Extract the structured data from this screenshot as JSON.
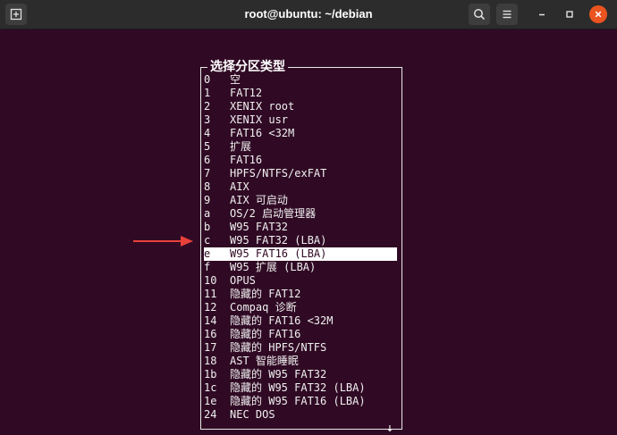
{
  "window": {
    "title": "root@ubuntu: ~/debian"
  },
  "dialog": {
    "title": "选择分区类型",
    "scroll_indicator": "↓",
    "selected_index": 13,
    "items": [
      {
        "id": "0",
        "label": "空"
      },
      {
        "id": "1",
        "label": "FAT12"
      },
      {
        "id": "2",
        "label": "XENIX root"
      },
      {
        "id": "3",
        "label": "XENIX usr"
      },
      {
        "id": "4",
        "label": "FAT16 <32M"
      },
      {
        "id": "5",
        "label": "扩展"
      },
      {
        "id": "6",
        "label": "FAT16"
      },
      {
        "id": "7",
        "label": "HPFS/NTFS/exFAT"
      },
      {
        "id": "8",
        "label": "AIX"
      },
      {
        "id": "9",
        "label": "AIX 可启动"
      },
      {
        "id": "a",
        "label": "OS/2 启动管理器"
      },
      {
        "id": "b",
        "label": "W95 FAT32"
      },
      {
        "id": "c",
        "label": "W95 FAT32 (LBA)"
      },
      {
        "id": "e",
        "label": "W95 FAT16 (LBA)"
      },
      {
        "id": "f",
        "label": "W95 扩展 (LBA)"
      },
      {
        "id": "10",
        "label": "OPUS"
      },
      {
        "id": "11",
        "label": "隐藏的 FAT12"
      },
      {
        "id": "12",
        "label": "Compaq 诊断"
      },
      {
        "id": "14",
        "label": "隐藏的 FAT16 <32M"
      },
      {
        "id": "16",
        "label": "隐藏的 FAT16"
      },
      {
        "id": "17",
        "label": "隐藏的 HPFS/NTFS"
      },
      {
        "id": "18",
        "label": "AST 智能睡眠"
      },
      {
        "id": "1b",
        "label": "隐藏的 W95 FAT32"
      },
      {
        "id": "1c",
        "label": "隐藏的 W95 FAT32 (LBA)"
      },
      {
        "id": "1e",
        "label": "隐藏的 W95 FAT16 (LBA)"
      },
      {
        "id": "24",
        "label": "NEC DOS"
      }
    ]
  },
  "colors": {
    "terminal_bg": "#300a24",
    "highlight_bg": "#ffffff",
    "annotation_arrow": "#e8413a",
    "close_button": "#e95420"
  },
  "icons": {
    "new_tab": "new-tab-icon",
    "search": "search-icon",
    "menu": "hamburger-menu-icon",
    "minimize": "minimize-icon",
    "maximize": "maximize-icon",
    "close": "close-icon",
    "annotation": "red-arrow-icon"
  }
}
